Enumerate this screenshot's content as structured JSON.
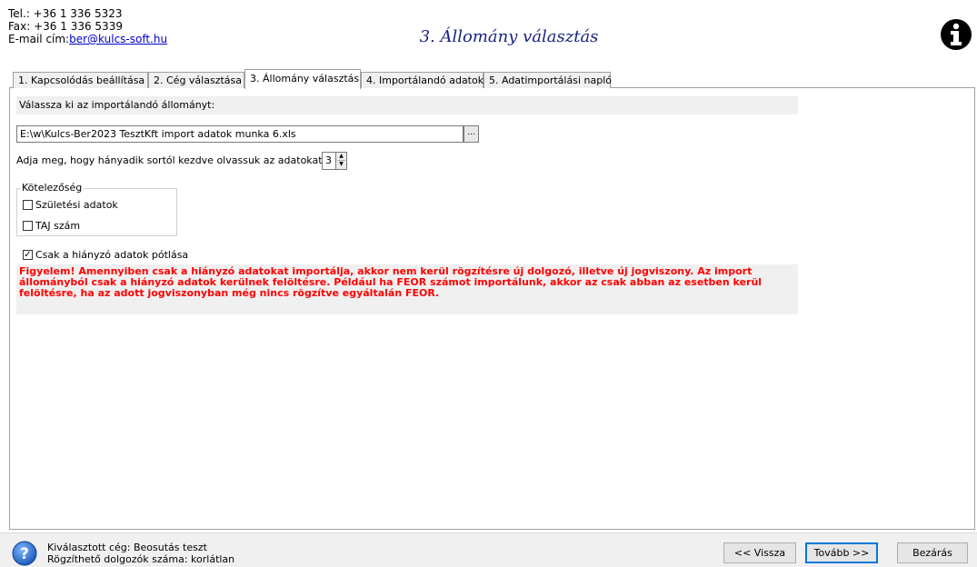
{
  "header": {
    "phone": "Tel.: +36 1 336 5323",
    "fax": "Fax: +36 1 336 5339",
    "email_label": "E-mail cím:",
    "email": "ber@kulcs-soft.hu",
    "title": "3. Állomány választás"
  },
  "tabs": [
    {
      "label": "1. Kapcsolódás beállítása"
    },
    {
      "label": "2. Cég választása"
    },
    {
      "label": "3. Állomány választás"
    },
    {
      "label": "4. Importálandó adatok"
    },
    {
      "label": "5. Adatimportálási napló"
    }
  ],
  "main": {
    "select_file_label": "Válassza ki az importálandó állományt:",
    "file_path": "E:\\w\\Kulcs-Ber2023 TesztKft import adatok munka 6.xls",
    "browse_label": "...",
    "start_row_label": "Adja meg, hogy hányadik sortól kezdve olvassuk az adatokat:",
    "start_row_value": "3",
    "group_title": "Kötelezőség",
    "chk_birth": "Születési adatok",
    "chk_taj": "TAJ szám",
    "chk_missing_only": "Csak a hiányzó adatok pótlása",
    "chk_missing_only_checked": true,
    "warning": "Figyelem! Amennyiben csak a hiányzó adatokat importálja, akkor nem kerül rögzítésre új dolgozó, illetve új jogviszony. Az import állományból csak a hiányzó adatok kerülnek felöltésre. Például ha FEOR számot importálunk, akkor az csak abban az esetben kerül felöltésre, ha az adott jogviszonyban még nincs rögzítve egyáltalán FEOR."
  },
  "status": {
    "company": "Kiválasztott cég: Beosutás teszt",
    "employees": "Rögzíthető dolgozók száma: korlátlan"
  },
  "buttons": {
    "back": "<< Vissza",
    "next": "Tovább >>",
    "close": "Bezárás"
  },
  "colors": {
    "title": "#1a237e",
    "warning": "#ff0000",
    "link": "#0000cc"
  },
  "icons": {
    "info": "info-icon",
    "help": "help-icon"
  }
}
